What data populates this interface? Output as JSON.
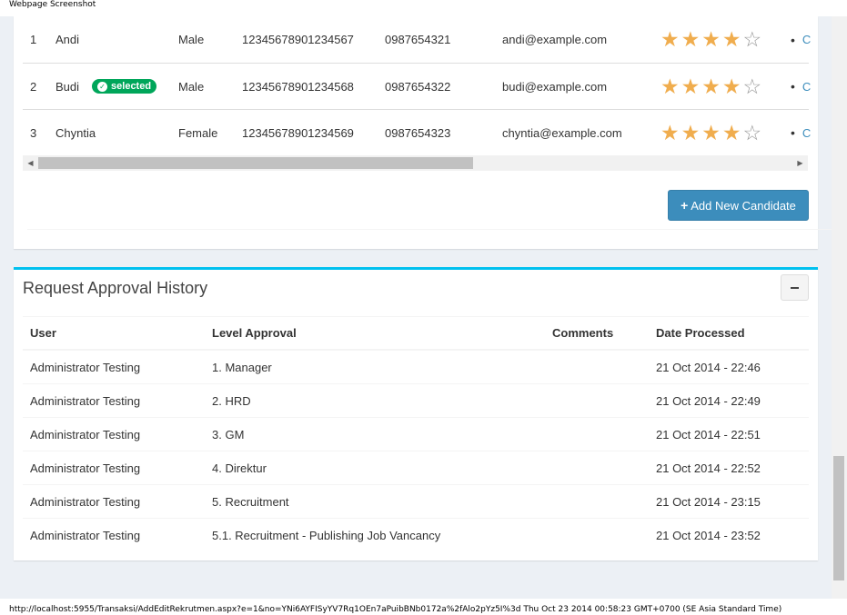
{
  "print_header": "Webpage Screenshot",
  "print_footer": "http://localhost:5955/Transaksi/AddEditRekrutmen.aspx?e=1&no=YNi6AYFISyYV7Rq1OEn7aPuibBNb0172a%2fAlo2pYz5I%3d Thu Oct 23 2014 00:58:23 GMT+0700 (SE Asia Standard Time)",
  "candidates": {
    "rows": [
      {
        "no": "1",
        "name": "Andi",
        "selected": false,
        "gender": "Male",
        "id_number": "12345678901234567",
        "phone": "0987654321",
        "email": "andi@example.com",
        "rating": 4,
        "rating_max": 5
      },
      {
        "no": "2",
        "name": "Budi",
        "selected": true,
        "gender": "Male",
        "id_number": "12345678901234568",
        "phone": "0987654322",
        "email": "budi@example.com",
        "rating": 4,
        "rating_max": 5
      },
      {
        "no": "3",
        "name": "Chyntia",
        "selected": false,
        "gender": "Female",
        "id_number": "12345678901234569",
        "phone": "0987654323",
        "email": "chyntia@example.com",
        "rating": 4,
        "rating_max": 5
      }
    ],
    "selected_label": "selected",
    "bullet": "•",
    "link_fragment": "C",
    "add_button_label": "Add New Candidate",
    "add_button_icon": "plus-icon"
  },
  "approval": {
    "title": "Request Approval History",
    "collapse_icon": "minus-icon",
    "columns": [
      "User",
      "Level Approval",
      "Comments",
      "Date Processed"
    ],
    "rows": [
      {
        "user": "Administrator Testing",
        "level": "1. Manager",
        "comments": "",
        "date": "21 Oct 2014 - 22:46"
      },
      {
        "user": "Administrator Testing",
        "level": "2. HRD",
        "comments": "",
        "date": "21 Oct 2014 - 22:49"
      },
      {
        "user": "Administrator Testing",
        "level": "3. GM",
        "comments": "",
        "date": "21 Oct 2014 - 22:51"
      },
      {
        "user": "Administrator Testing",
        "level": "4. Direktur",
        "comments": "",
        "date": "21 Oct 2014 - 22:52"
      },
      {
        "user": "Administrator Testing",
        "level": "5. Recruitment",
        "comments": "",
        "date": "21 Oct 2014 - 23:15"
      },
      {
        "user": "Administrator Testing",
        "level": "5.1. Recruitment - Publishing Job Vancancy",
        "comments": "",
        "date": "21 Oct 2014 - 23:52"
      }
    ]
  },
  "colors": {
    "primary": "#3c8dbc",
    "success": "#00a65a",
    "info_border": "#00c0ef",
    "star": "#f0ad4e"
  }
}
